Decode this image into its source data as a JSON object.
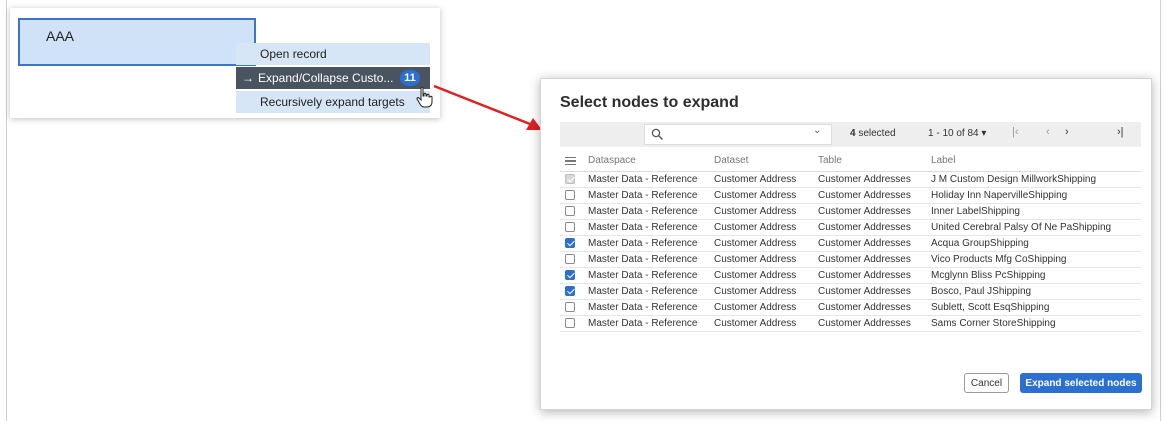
{
  "graph": {
    "node_label": "AAA"
  },
  "context_menu": {
    "items": [
      {
        "label": "Open record"
      },
      {
        "label": "Expand/Collapse Custo...",
        "badge": "11"
      },
      {
        "label": "Recursively expand targets"
      }
    ]
  },
  "dialog": {
    "title": "Select nodes to expand",
    "search": {
      "value": "",
      "placeholder": ""
    },
    "selected_count": "4",
    "selected_suffix": " selected",
    "paging": "1 - 10 of 84 ▾",
    "columns": [
      "Dataspace",
      "Dataset",
      "Table",
      "Label"
    ],
    "rows": [
      {
        "state": "disabled",
        "dataspace": "Master Data - Reference",
        "dataset": "Customer Address",
        "table": "Customer Addresses",
        "label": "J M Custom Design MillworkShipping"
      },
      {
        "state": "unchecked",
        "dataspace": "Master Data - Reference",
        "dataset": "Customer Address",
        "table": "Customer Addresses",
        "label": "Holiday Inn NapervilleShipping"
      },
      {
        "state": "unchecked",
        "dataspace": "Master Data - Reference",
        "dataset": "Customer Address",
        "table": "Customer Addresses",
        "label": "Inner LabelShipping"
      },
      {
        "state": "unchecked",
        "dataspace": "Master Data - Reference",
        "dataset": "Customer Address",
        "table": "Customer Addresses",
        "label": "United Cerebral Palsy Of Ne PaShipping"
      },
      {
        "state": "checked",
        "dataspace": "Master Data - Reference",
        "dataset": "Customer Address",
        "table": "Customer Addresses",
        "label": "Acqua GroupShipping"
      },
      {
        "state": "unchecked",
        "dataspace": "Master Data - Reference",
        "dataset": "Customer Address",
        "table": "Customer Addresses",
        "label": "Vico Products Mfg CoShipping"
      },
      {
        "state": "checked",
        "dataspace": "Master Data - Reference",
        "dataset": "Customer Address",
        "table": "Customer Addresses",
        "label": "Mcglynn Bliss PcShipping"
      },
      {
        "state": "checked",
        "dataspace": "Master Data - Reference",
        "dataset": "Customer Address",
        "table": "Customer Addresses",
        "label": "Bosco, Paul JShipping"
      },
      {
        "state": "unchecked",
        "dataspace": "Master Data - Reference",
        "dataset": "Customer Address",
        "table": "Customer Addresses",
        "label": "Sublett, Scott EsqShipping"
      },
      {
        "state": "unchecked",
        "dataspace": "Master Data - Reference",
        "dataset": "Customer Address",
        "table": "Customer Addresses",
        "label": "Sams Corner StoreShipping"
      }
    ],
    "buttons": {
      "cancel": "Cancel",
      "confirm": "Expand selected nodes"
    }
  },
  "colors": {
    "accent": "#2b6fd1",
    "node_fill": "#cfe2f7",
    "menu_active": "#4a5360",
    "arrow": "#e02020"
  },
  "icons": {
    "search": "search-icon",
    "cursor": "hand-pointer-icon",
    "column_menu": "hamburger-menu-icon"
  }
}
